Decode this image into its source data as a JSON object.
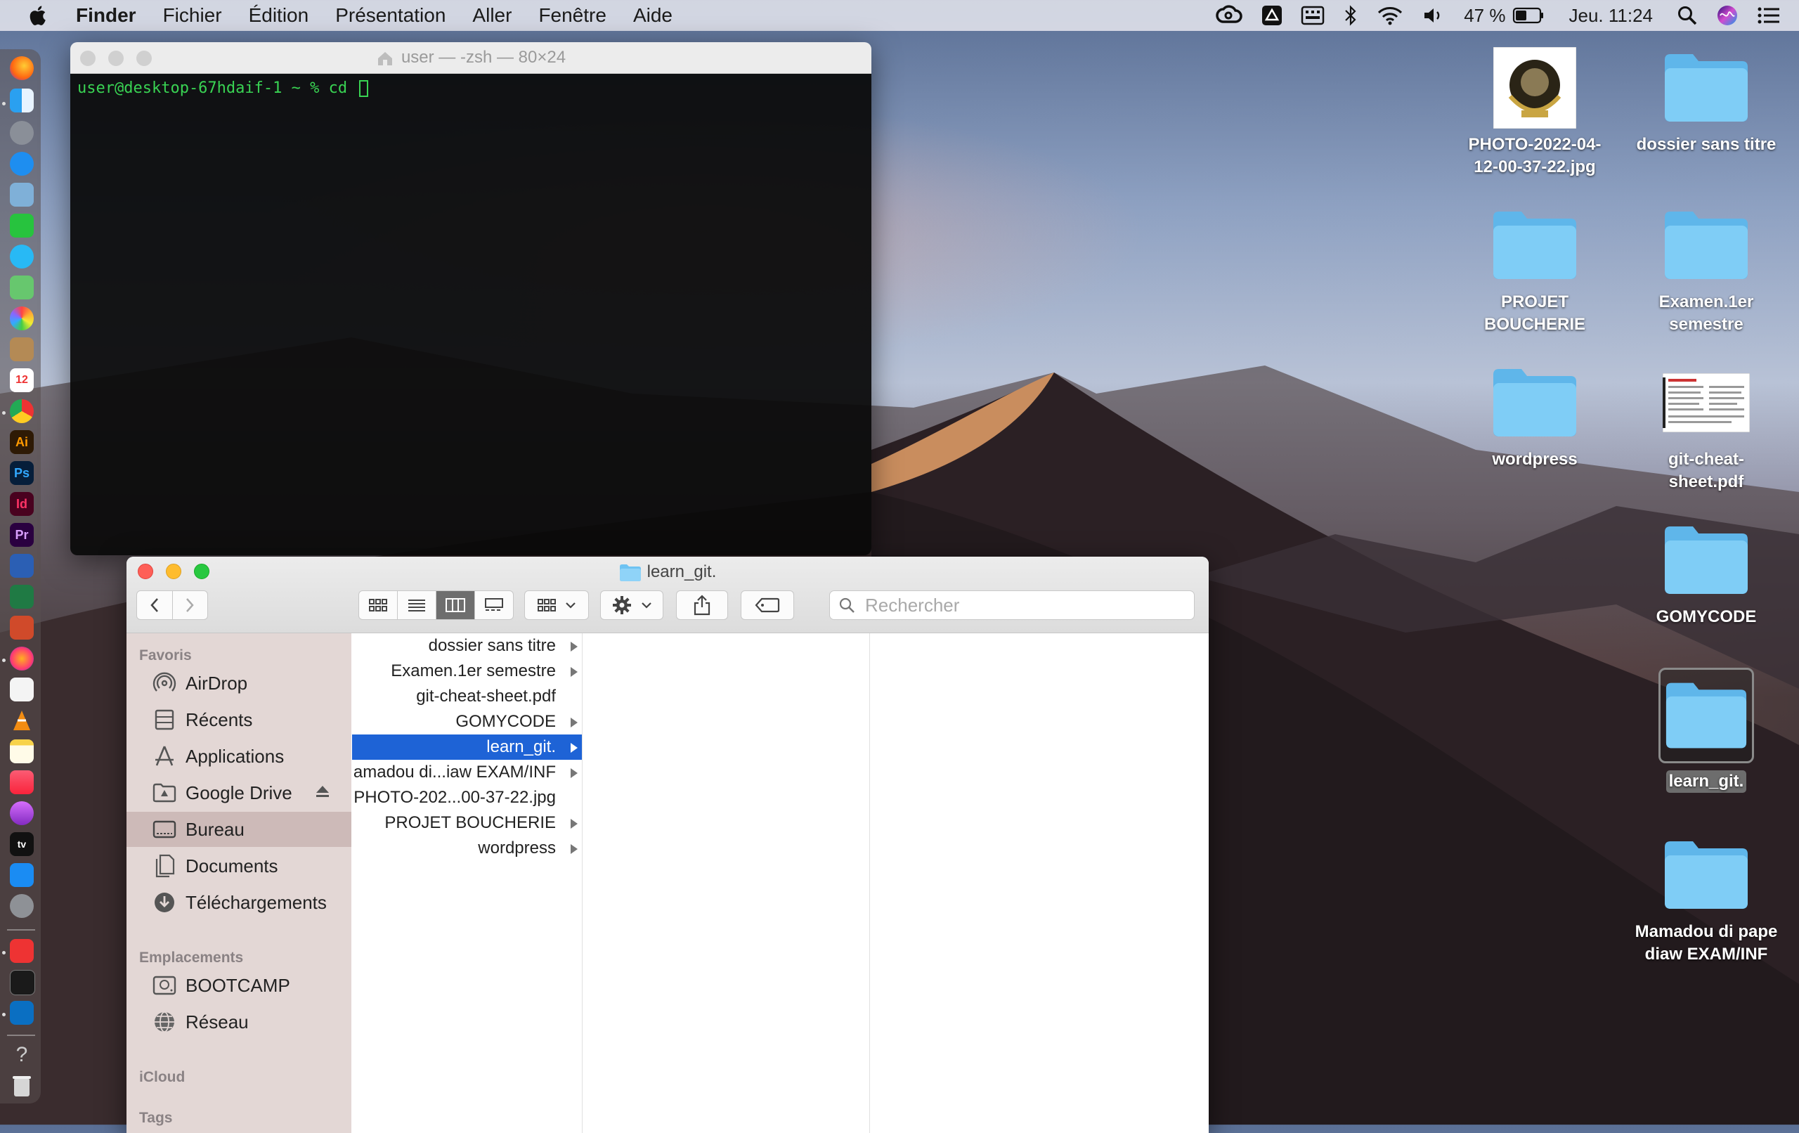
{
  "menubar": {
    "app_name": "Finder",
    "items": [
      "Fichier",
      "Édition",
      "Présentation",
      "Aller",
      "Fenêtre",
      "Aide"
    ],
    "battery": "47 %",
    "clock": "Jeu. 11:24"
  },
  "terminal": {
    "title": "user — -zsh — 80×24",
    "prompt": "user@desktop-67hdaif-1 ~ % cd "
  },
  "finder": {
    "title": "learn_git.",
    "search_placeholder": "Rechercher",
    "sidebar": {
      "favoris_heading": "Favoris",
      "favoris": [
        "AirDrop",
        "Récents",
        "Applications",
        "Google Drive",
        "Bureau",
        "Documents",
        "Téléchargements"
      ],
      "emplacements_heading": "Emplacements",
      "emplacements": [
        "BOOTCAMP",
        "Réseau"
      ],
      "icloud_heading": "iCloud",
      "tags_heading": "Tags"
    },
    "column_items": [
      "dossier sans titre",
      "Examen.1er semestre",
      "git-cheat-sheet.pdf",
      "GOMYCODE",
      "learn_git.",
      "Mamadou di...iaw EXAM/INF",
      "PHOTO-202...00-37-22.jpg",
      "PROJET BOUCHERIE",
      "wordpress"
    ]
  },
  "desktop": {
    "items": [
      {
        "name": "PHOTO-2022-04-12-00-37-22.jpg",
        "line1": "PHOTO-2022-04-",
        "line2": "12-00-37-22.jpg"
      },
      {
        "name": "dossier sans titre",
        "line1": "dossier sans titre",
        "line2": ""
      },
      {
        "name": "PROJET BOUCHERIE",
        "line1": "PROJET",
        "line2": "BOUCHERIE"
      },
      {
        "name": "Examen.1er semestre",
        "line1": "Examen.1er",
        "line2": "semestre"
      },
      {
        "name": "wordpress",
        "line1": "wordpress",
        "line2": ""
      },
      {
        "name": "git-cheat-sheet.pdf",
        "line1": "git-cheat-",
        "line2": "sheet.pdf"
      },
      {
        "name": "GOMYCODE",
        "line1": "GOMYCODE",
        "line2": ""
      },
      {
        "name": "learn_git.",
        "line1": "learn_git.",
        "line2": ""
      },
      {
        "name": "Mamadou di pape diaw EXAM/INF",
        "line1": "Mamadou di pape",
        "line2": "diaw EXAM/INF"
      }
    ]
  },
  "dock": {
    "labels": {
      "ai": "Ai",
      "ps": "Ps",
      "id": "Id",
      "pr": "Pr",
      "cal": "12",
      "tv": "tv"
    }
  },
  "colors": {
    "accent": "#1e63d6",
    "folder": "#6ec3f2",
    "terminal_green": "#39d353"
  }
}
